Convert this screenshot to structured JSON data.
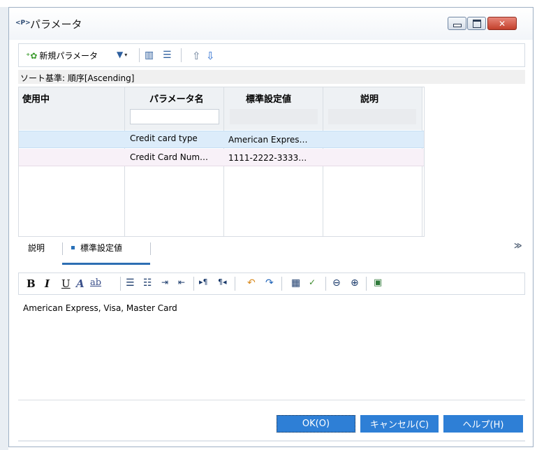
{
  "window": {
    "title": "パラメータ",
    "app_icon": "<P>",
    "controls": {
      "close": "✕"
    }
  },
  "toolbar": {
    "new_parameter": "新規パラメータ",
    "icons": [
      "new-parameter-icon",
      "filter-icon",
      "grid-icon",
      "properties-icon",
      "move-up-icon",
      "move-down-icon"
    ]
  },
  "sort": {
    "label": "ソート基準: 順序[Ascending]"
  },
  "table": {
    "columns": [
      "使用中",
      "パラメータ名",
      "標準設定値",
      "説明"
    ],
    "rows": [
      {
        "in_use": "",
        "name": "Credit card type",
        "default": "American Expres…",
        "description": ""
      },
      {
        "in_use": "",
        "name": "Credit Card Num…",
        "default": "1111-2222-3333…",
        "description": ""
      }
    ]
  },
  "tabs": [
    {
      "label": "説明",
      "active": false
    },
    {
      "label": "標準設定値",
      "active": true
    }
  ],
  "editor": {
    "text": "American Express, Visa, Master Card",
    "format_labels": {
      "bold": "B",
      "italic": "I",
      "underline": "U",
      "font_color": "A",
      "highlight": "ab"
    }
  },
  "buttons": {
    "ok": "OK(O)",
    "cancel": "キャンセル(C)",
    "help": "ヘルプ(H)"
  },
  "colors": {
    "accent": "#2e7fd6",
    "selected_row": "#dcecfa",
    "close_button": "#c3402c"
  }
}
